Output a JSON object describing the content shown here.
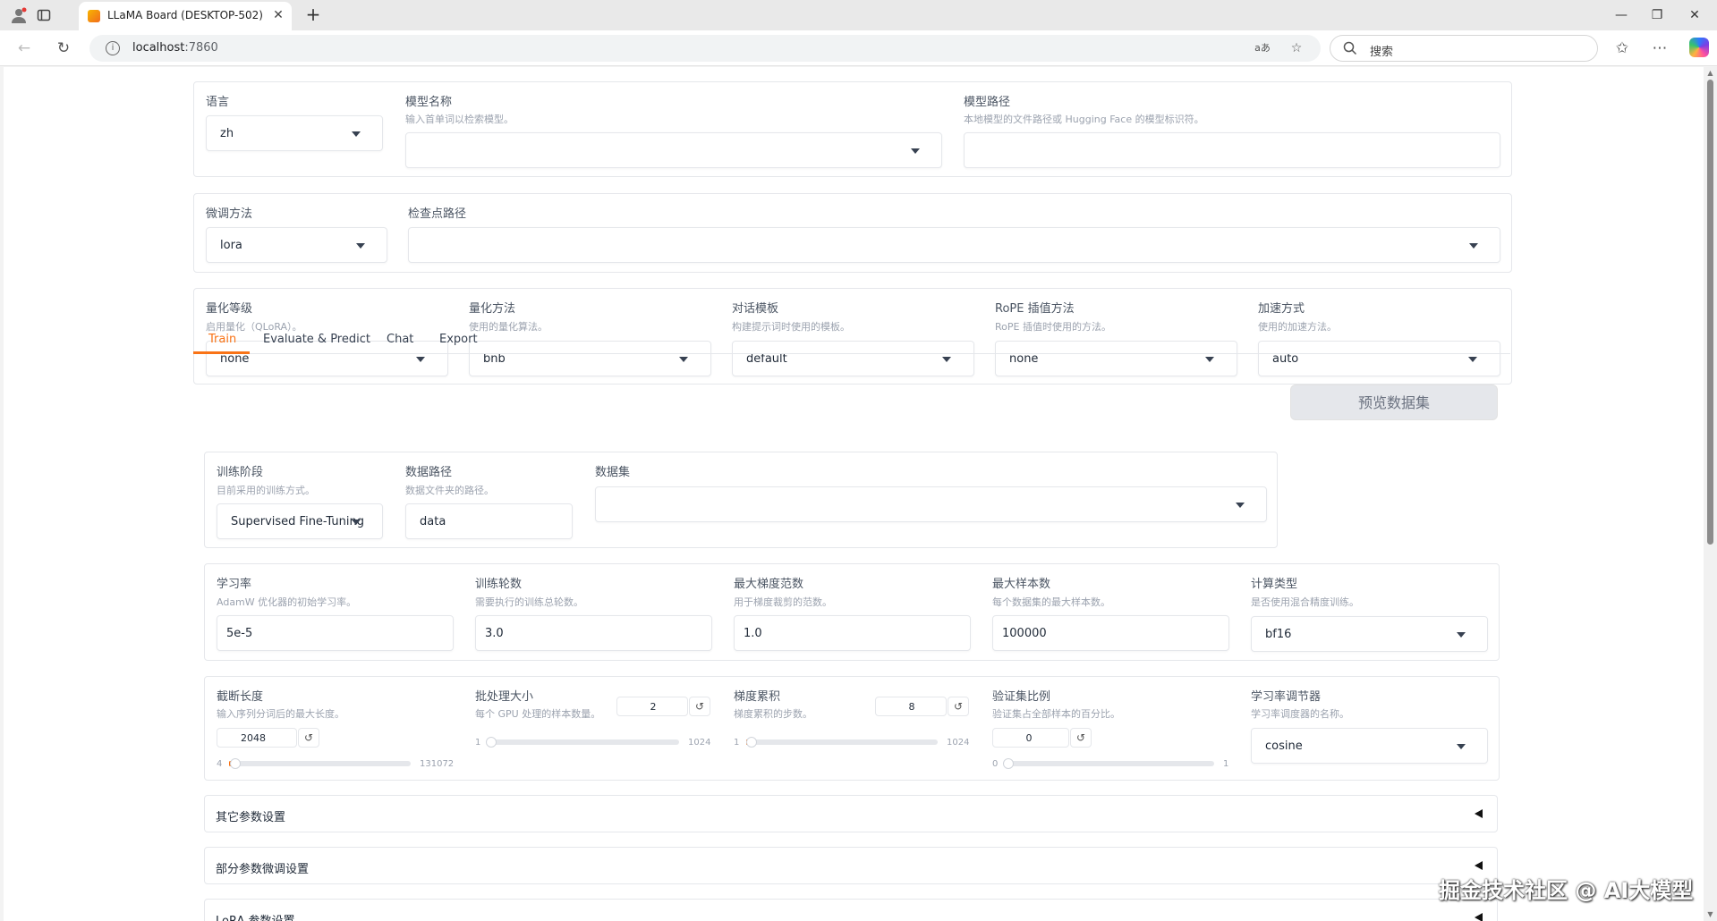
{
  "browser": {
    "tab_title": "LLaMA Board (DESKTOP-502)",
    "url_host": "localhost",
    "url_port": ":7860",
    "search_placeholder": "搜索",
    "read_aloud_label": "aあ"
  },
  "top": {
    "lang": {
      "label": "语言",
      "value": "zh"
    },
    "model_name": {
      "label": "模型名称",
      "info": "输入首单词以检索模型。",
      "value": ""
    },
    "model_path": {
      "label": "模型路径",
      "info": "本地模型的文件路径或 Hugging Face 的模型标识符。",
      "value": ""
    }
  },
  "finetune": {
    "method": {
      "label": "微调方法",
      "value": "lora"
    },
    "checkpoint": {
      "label": "检查点路径",
      "value": ""
    }
  },
  "quant": {
    "bit": {
      "label": "量化等级",
      "info": "启用量化（QLoRA）。",
      "value": "none"
    },
    "method": {
      "label": "量化方法",
      "info": "使用的量化算法。",
      "value": "bnb"
    },
    "template": {
      "label": "对话模板",
      "info": "构建提示词时使用的模板。",
      "value": "default"
    },
    "rope": {
      "label": "RoPE 插值方法",
      "info": "RoPE 插值时使用的方法。",
      "value": "none"
    },
    "booster": {
      "label": "加速方式",
      "info": "使用的加速方法。",
      "value": "auto"
    }
  },
  "tabs": [
    "Train",
    "Evaluate & Predict",
    "Chat",
    "Export"
  ],
  "train": {
    "stage": {
      "label": "训练阶段",
      "info": "目前采用的训练方式。",
      "value": "Supervised Fine-Tuning"
    },
    "dataset_dir": {
      "label": "数据路径",
      "info": "数据文件夹的路径。",
      "value": "data"
    },
    "dataset": {
      "label": "数据集",
      "value": ""
    },
    "preview_button": "预览数据集",
    "lr": {
      "label": "学习率",
      "info": "AdamW 优化器的初始学习率。",
      "value": "5e-5"
    },
    "epochs": {
      "label": "训练轮数",
      "info": "需要执行的训练总轮数。",
      "value": "3.0"
    },
    "max_grad_norm": {
      "label": "最大梯度范数",
      "info": "用于梯度裁剪的范数。",
      "value": "1.0"
    },
    "max_samples": {
      "label": "最大样本数",
      "info": "每个数据集的最大样本数。",
      "value": "100000"
    },
    "compute_type": {
      "label": "计算类型",
      "info": "是否使用混合精度训练。",
      "value": "bf16"
    },
    "cutoff_len": {
      "label": "截断长度",
      "info": "输入序列分词后的最大长度。",
      "value": "2048",
      "min": "4",
      "max": "131072",
      "fraction": 0.016
    },
    "batch_size": {
      "label": "批处理大小",
      "info": "每个 GPU 处理的样本数量。",
      "value": "2",
      "min": "1",
      "max": "1024",
      "fraction": 0.001
    },
    "grad_accum": {
      "label": "梯度累积",
      "info": "梯度累积的步数。",
      "value": "8",
      "min": "1",
      "max": "1024",
      "fraction": 0.007
    },
    "val_size": {
      "label": "验证集比例",
      "info": "验证集占全部样本的百分比。",
      "value": "0",
      "min": "0",
      "max": "1",
      "fraction": 0.0
    },
    "scheduler": {
      "label": "学习率调节器",
      "info": "学习率调度器的名称。",
      "value": "cosine"
    },
    "accordions": [
      "其它参数设置",
      "部分参数微调设置",
      "LoRA 参数设置"
    ]
  },
  "reset_symbol": "↺",
  "watermark": "掘金技术社区 @ AI大模型",
  "colors": {
    "accent": "#f97316",
    "button_bg": "#e5e7eb",
    "border": "#e5e7eb",
    "slider_fill": "#f97316"
  }
}
